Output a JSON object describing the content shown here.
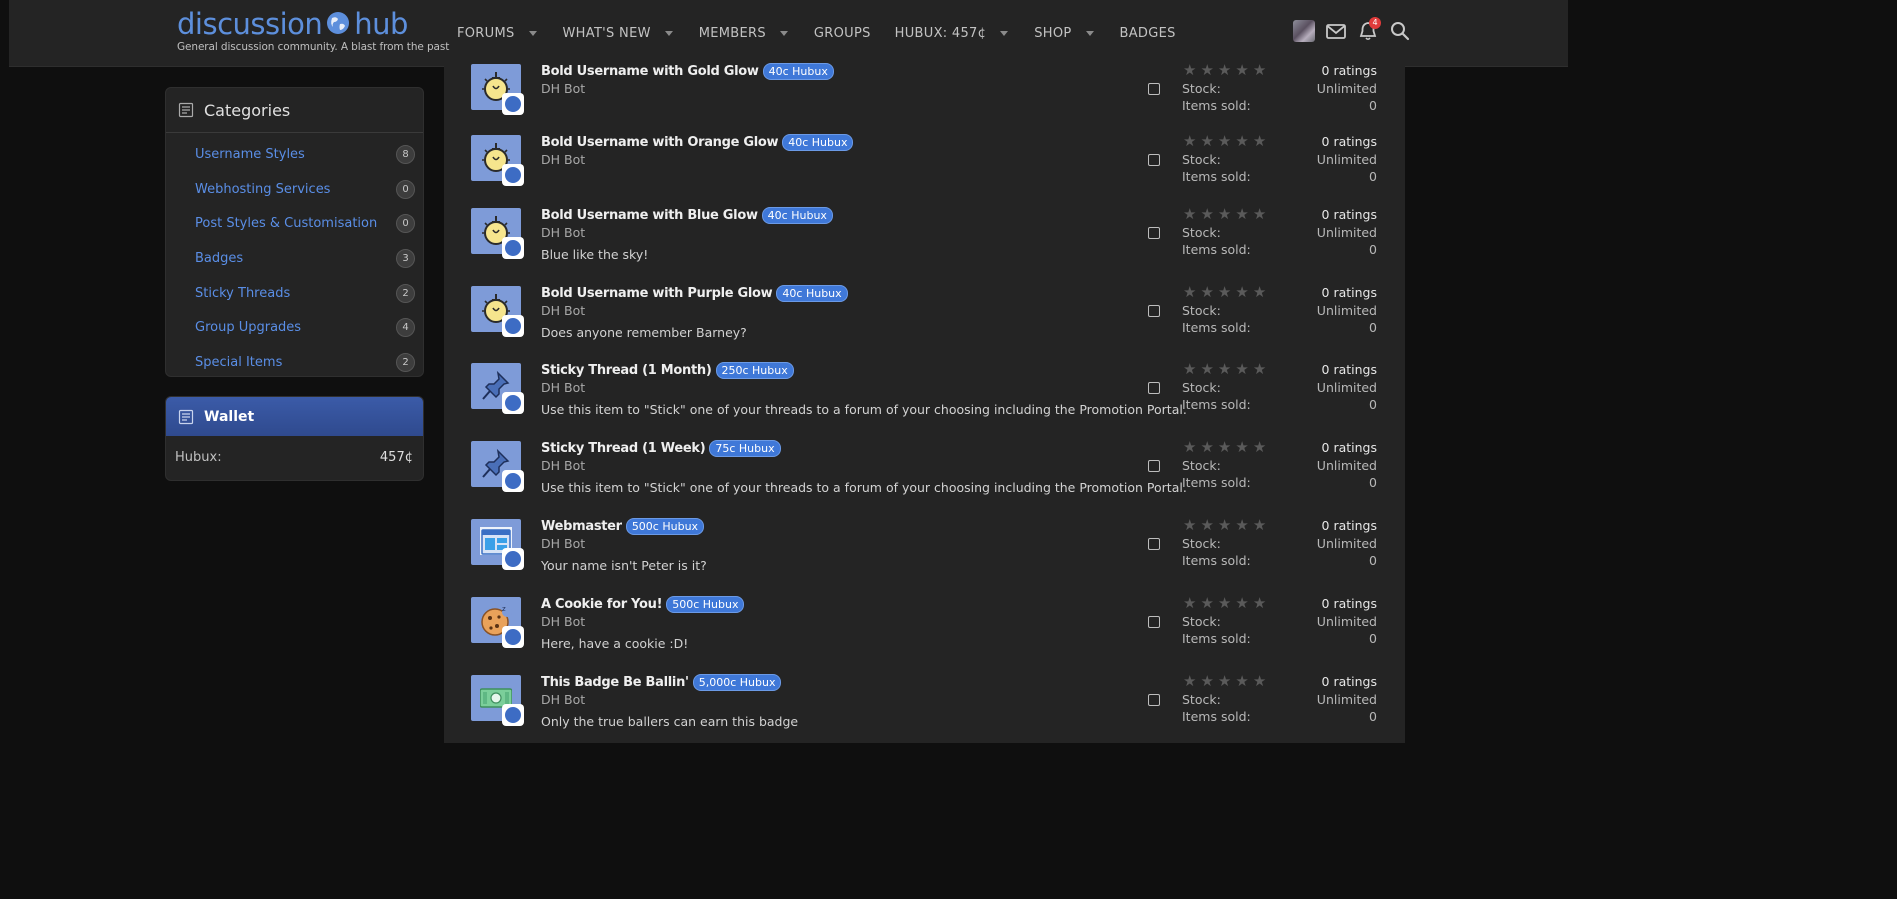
{
  "header": {
    "logo_left": "discussion",
    "logo_right": "hub",
    "tagline": "General discussion community. A blast from the past",
    "nav": [
      {
        "label": "FORUMS",
        "caret": true
      },
      {
        "label": "WHAT'S NEW",
        "caret": true
      },
      {
        "label": "MEMBERS",
        "caret": true
      },
      {
        "label": "GROUPS",
        "caret": false
      },
      {
        "label": "HUBUX: 457¢",
        "caret": true
      },
      {
        "label": "SHOP",
        "caret": true
      },
      {
        "label": "BADGES",
        "caret": false
      }
    ],
    "notification_count": "4"
  },
  "categories": {
    "title": "Categories",
    "items": [
      {
        "label": "Username Styles",
        "count": "8"
      },
      {
        "label": "Webhosting Services",
        "count": "0"
      },
      {
        "label": "Post Styles & Customisation",
        "count": "0"
      },
      {
        "label": "Badges",
        "count": "3"
      },
      {
        "label": "Sticky Threads",
        "count": "2"
      },
      {
        "label": "Group Upgrades",
        "count": "4"
      },
      {
        "label": "Special Items",
        "count": "2"
      }
    ]
  },
  "wallet": {
    "title": "Wallet",
    "label": "Hubux:",
    "value": "457¢"
  },
  "labels": {
    "stock": "Stock:",
    "items_sold": "Items sold:"
  },
  "items": [
    {
      "title": "Bold Username with Gold Glow",
      "price": "40c Hubux",
      "author": "DH Bot",
      "desc": "",
      "icon": "bulb-icon",
      "ratings": "0 ratings",
      "stock": "Unlimited",
      "sold": "0"
    },
    {
      "title": "Bold Username with Orange Glow",
      "price": "40c Hubux",
      "author": "DH Bot",
      "desc": "",
      "icon": "bulb-icon",
      "ratings": "0 ratings",
      "stock": "Unlimited",
      "sold": "0"
    },
    {
      "title": "Bold Username with Blue Glow",
      "price": "40c Hubux",
      "author": "DH Bot",
      "desc": "Blue like the sky!",
      "icon": "bulb-icon",
      "ratings": "0 ratings",
      "stock": "Unlimited",
      "sold": "0"
    },
    {
      "title": "Bold Username with Purple Glow",
      "price": "40c Hubux",
      "author": "DH Bot",
      "desc": "Does anyone remember Barney?",
      "icon": "bulb-icon",
      "ratings": "0 ratings",
      "stock": "Unlimited",
      "sold": "0"
    },
    {
      "title": "Sticky Thread (1 Month)",
      "price": "250c Hubux",
      "author": "DH Bot",
      "desc": "Use this item to \"Stick\" one of your threads to a forum of your choosing including the Promotion Portal.",
      "icon": "pin-icon",
      "ratings": "0 ratings",
      "stock": "Unlimited",
      "sold": "0"
    },
    {
      "title": "Sticky Thread (1 Week)",
      "price": "75c Hubux",
      "author": "DH Bot",
      "desc": "Use this item to \"Stick\" one of your threads to a forum of your choosing including the Promotion Portal.",
      "icon": "pin-icon",
      "ratings": "0 ratings",
      "stock": "Unlimited",
      "sold": "0"
    },
    {
      "title": "Webmaster",
      "price": "500c Hubux",
      "author": "DH Bot",
      "desc": "Your name isn't Peter is it?",
      "icon": "browser-icon",
      "ratings": "0 ratings",
      "stock": "Unlimited",
      "sold": "0"
    },
    {
      "title": "A Cookie for You!",
      "price": "500c Hubux",
      "author": "DH Bot",
      "desc": "Here, have a cookie :D!",
      "icon": "cookie-icon",
      "ratings": "0 ratings",
      "stock": "Unlimited",
      "sold": "0"
    },
    {
      "title": "This Badge Be Ballin'",
      "price": "5,000c Hubux",
      "author": "DH Bot",
      "desc": "Only the true ballers can earn this badge",
      "icon": "cash-icon",
      "ratings": "0 ratings",
      "stock": "Unlimited",
      "sold": "0"
    }
  ],
  "colors": {
    "accent": "#5a8ee6",
    "price_badge": "#3f78d8",
    "background": "#0f0f0f",
    "panel": "#242424"
  }
}
